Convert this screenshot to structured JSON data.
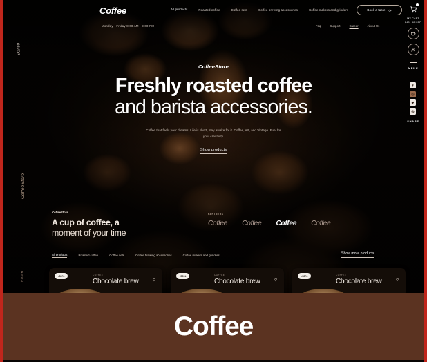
{
  "brand": "Coffee",
  "nav": {
    "items": [
      {
        "label": "All products",
        "active": true
      },
      {
        "label": "Roasted coffee",
        "active": false
      },
      {
        "label": "Coffee sets",
        "active": false
      },
      {
        "label": "Coffee brewing accessories",
        "active": false
      },
      {
        "label": "Coffee makers and grinders",
        "active": false
      }
    ],
    "book_button": "Book a table",
    "book_icon": "coffee-cup-icon"
  },
  "cart": {
    "icon": "shopping-cart-icon",
    "label": "MY CART",
    "amount": "$461.59 USD"
  },
  "hours": "Monday - Friday  8:00 AM - 9:00 PM",
  "subnav": [
    {
      "label": "Faq",
      "underline": false
    },
    {
      "label": "Support",
      "underline": false
    },
    {
      "label": "Career",
      "underline": true
    },
    {
      "label": "About Us",
      "underline": false
    }
  ],
  "left_rail": {
    "counter": "01/03",
    "vertical_label": "CoffeeStore",
    "scroll_label": "DOWN"
  },
  "right_rail": {
    "cup_icon": "coffee-cup-icon",
    "account_icon": "user-account-icon",
    "menu_label": "MENU",
    "share_label": "SHARE",
    "social_icons": [
      "facebook-icon",
      "instagram-icon",
      "twitter-icon",
      "pinterest-icon"
    ]
  },
  "hero": {
    "kicker": "CoffeeStore",
    "headline_line1": "Freshly roasted coffee",
    "headline_line2": "and barista accessories.",
    "lead": "Coffee that feels your dreams. Life is short, stay awake for it. Coffee, Art, and Vintage. Fuel for your creativity.",
    "cta": "Show products"
  },
  "band": {
    "label": "CoffeeStore",
    "title_line1": "A cup of coffee, a",
    "title_line2": "moment of your time",
    "partners_label": "PARTNERS",
    "partners": [
      {
        "name": "Coffee",
        "highlight": false
      },
      {
        "name": "Coffee",
        "highlight": false
      },
      {
        "name": "Coffee",
        "highlight": true
      },
      {
        "name": "Coffee",
        "highlight": false
      }
    ],
    "filters": [
      {
        "label": "All products",
        "active": true
      },
      {
        "label": "Roasted coffee",
        "active": false
      },
      {
        "label": "Coffee sets",
        "active": false
      },
      {
        "label": "Coffee brewing accessories",
        "active": false
      },
      {
        "label": "Coffee makers and grinders",
        "active": false
      }
    ],
    "show_more": "Show more products"
  },
  "products": [
    {
      "discount": "-50%",
      "category": "COFFEE",
      "title": "Chocolate brew",
      "favorite_icon": "heart-icon"
    },
    {
      "discount": "-50%",
      "category": "COFFEE",
      "title": "Chocolate brew",
      "favorite_icon": "heart-icon"
    },
    {
      "discount": "-50%",
      "category": "COFFEE",
      "title": "Chocolate brew",
      "favorite_icon": "heart-icon"
    }
  ],
  "banner": {
    "text": "Coffee",
    "background_color": "#5b3321"
  },
  "frame_color": "#c0261c"
}
